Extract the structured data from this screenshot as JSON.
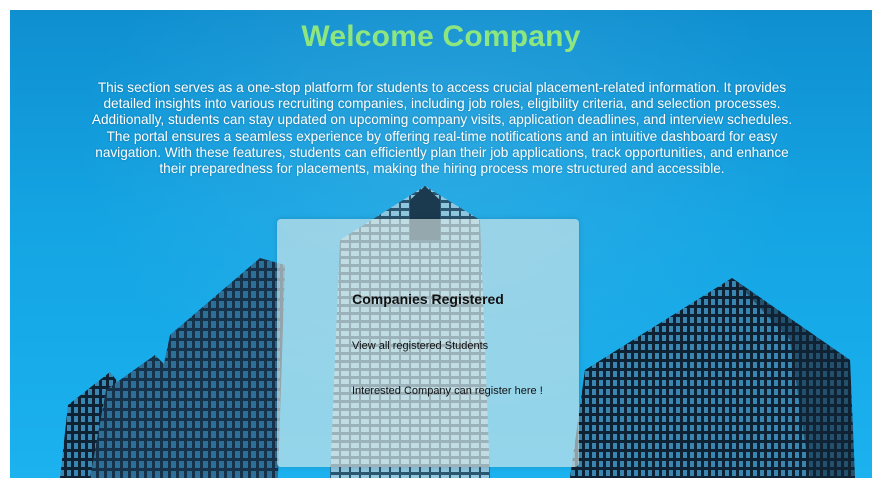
{
  "header": {
    "title": "Welcome Company"
  },
  "intro": {
    "text": "This section serves as a one-stop platform for students to access crucial placement-related information. It provides detailed insights into various recruiting companies, including job roles, eligibility criteria, and selection processes. Additionally, students can stay updated on upcoming company visits, application deadlines, and interview schedules. The portal ensures a seamless experience by offering real-time notifications and an intuitive dashboard for easy navigation. With these features, students can efficiently plan their job applications, track opportunities, and enhance their preparedness for placements, making the hiring process more structured and accessible."
  },
  "card": {
    "title": "Companies Registered",
    "links": [
      "View all registered Students",
      "Interested Company can register here !"
    ]
  },
  "colors": {
    "title": "#8ee67e",
    "sky": "#14a4e3",
    "card": "#e1ebe8"
  }
}
